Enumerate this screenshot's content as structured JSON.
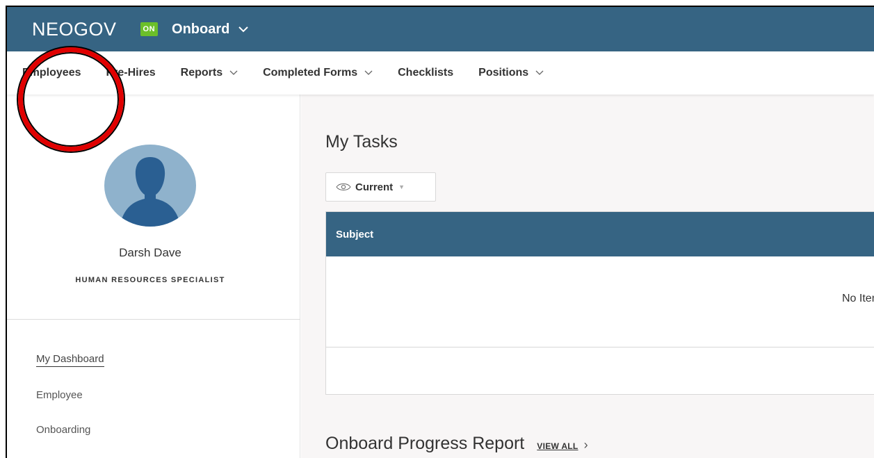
{
  "header": {
    "logo": "NEOGOV",
    "badge": "ON",
    "app_name": "Onboard"
  },
  "nav": {
    "items": [
      {
        "label": "Employees"
      },
      {
        "label": "Pre-Hires"
      },
      {
        "label": "Reports"
      },
      {
        "label": "Completed Forms"
      },
      {
        "label": "Checklists"
      },
      {
        "label": "Positions"
      }
    ]
  },
  "profile": {
    "name": "Darsh Dave",
    "title": "HUMAN RESOURCES SPECIALIST"
  },
  "sidebar": {
    "links": [
      {
        "label": "My Dashboard"
      },
      {
        "label": "Employee"
      },
      {
        "label": "Onboarding"
      }
    ]
  },
  "main": {
    "tasks_title": "My Tasks",
    "filter_label": "Current",
    "table_header": "Subject",
    "empty_text": "No Items",
    "progress_title": "Onboard Progress Report",
    "view_all": "VIEW ALL"
  },
  "colors": {
    "header_bg": "#366483",
    "badge_bg": "#6cbf2a",
    "annotation": "#e00000"
  }
}
